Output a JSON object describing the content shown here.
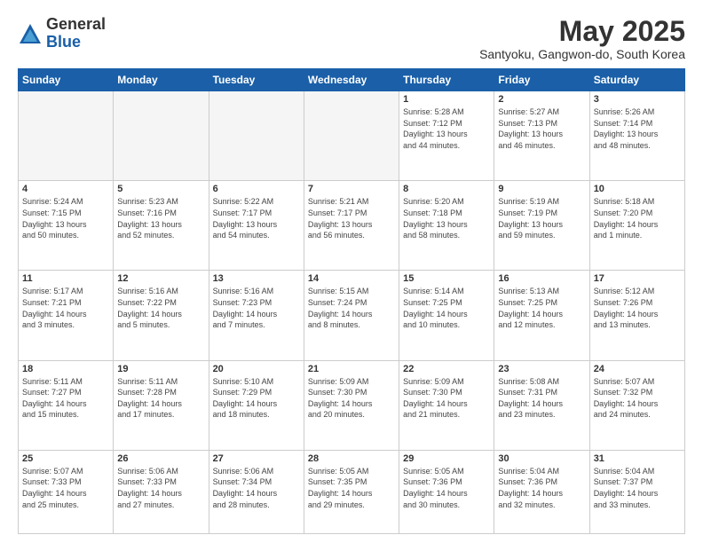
{
  "logo": {
    "general": "General",
    "blue": "Blue"
  },
  "title": "May 2025",
  "subtitle": "Santyoku, Gangwon-do, South Korea",
  "days_of_week": [
    "Sunday",
    "Monday",
    "Tuesday",
    "Wednesday",
    "Thursday",
    "Friday",
    "Saturday"
  ],
  "weeks": [
    [
      {
        "day": "",
        "info": ""
      },
      {
        "day": "",
        "info": ""
      },
      {
        "day": "",
        "info": ""
      },
      {
        "day": "",
        "info": ""
      },
      {
        "day": "1",
        "info": "Sunrise: 5:28 AM\nSunset: 7:12 PM\nDaylight: 13 hours\nand 44 minutes."
      },
      {
        "day": "2",
        "info": "Sunrise: 5:27 AM\nSunset: 7:13 PM\nDaylight: 13 hours\nand 46 minutes."
      },
      {
        "day": "3",
        "info": "Sunrise: 5:26 AM\nSunset: 7:14 PM\nDaylight: 13 hours\nand 48 minutes."
      }
    ],
    [
      {
        "day": "4",
        "info": "Sunrise: 5:24 AM\nSunset: 7:15 PM\nDaylight: 13 hours\nand 50 minutes."
      },
      {
        "day": "5",
        "info": "Sunrise: 5:23 AM\nSunset: 7:16 PM\nDaylight: 13 hours\nand 52 minutes."
      },
      {
        "day": "6",
        "info": "Sunrise: 5:22 AM\nSunset: 7:17 PM\nDaylight: 13 hours\nand 54 minutes."
      },
      {
        "day": "7",
        "info": "Sunrise: 5:21 AM\nSunset: 7:17 PM\nDaylight: 13 hours\nand 56 minutes."
      },
      {
        "day": "8",
        "info": "Sunrise: 5:20 AM\nSunset: 7:18 PM\nDaylight: 13 hours\nand 58 minutes."
      },
      {
        "day": "9",
        "info": "Sunrise: 5:19 AM\nSunset: 7:19 PM\nDaylight: 13 hours\nand 59 minutes."
      },
      {
        "day": "10",
        "info": "Sunrise: 5:18 AM\nSunset: 7:20 PM\nDaylight: 14 hours\nand 1 minute."
      }
    ],
    [
      {
        "day": "11",
        "info": "Sunrise: 5:17 AM\nSunset: 7:21 PM\nDaylight: 14 hours\nand 3 minutes."
      },
      {
        "day": "12",
        "info": "Sunrise: 5:16 AM\nSunset: 7:22 PM\nDaylight: 14 hours\nand 5 minutes."
      },
      {
        "day": "13",
        "info": "Sunrise: 5:16 AM\nSunset: 7:23 PM\nDaylight: 14 hours\nand 7 minutes."
      },
      {
        "day": "14",
        "info": "Sunrise: 5:15 AM\nSunset: 7:24 PM\nDaylight: 14 hours\nand 8 minutes."
      },
      {
        "day": "15",
        "info": "Sunrise: 5:14 AM\nSunset: 7:25 PM\nDaylight: 14 hours\nand 10 minutes."
      },
      {
        "day": "16",
        "info": "Sunrise: 5:13 AM\nSunset: 7:25 PM\nDaylight: 14 hours\nand 12 minutes."
      },
      {
        "day": "17",
        "info": "Sunrise: 5:12 AM\nSunset: 7:26 PM\nDaylight: 14 hours\nand 13 minutes."
      }
    ],
    [
      {
        "day": "18",
        "info": "Sunrise: 5:11 AM\nSunset: 7:27 PM\nDaylight: 14 hours\nand 15 minutes."
      },
      {
        "day": "19",
        "info": "Sunrise: 5:11 AM\nSunset: 7:28 PM\nDaylight: 14 hours\nand 17 minutes."
      },
      {
        "day": "20",
        "info": "Sunrise: 5:10 AM\nSunset: 7:29 PM\nDaylight: 14 hours\nand 18 minutes."
      },
      {
        "day": "21",
        "info": "Sunrise: 5:09 AM\nSunset: 7:30 PM\nDaylight: 14 hours\nand 20 minutes."
      },
      {
        "day": "22",
        "info": "Sunrise: 5:09 AM\nSunset: 7:30 PM\nDaylight: 14 hours\nand 21 minutes."
      },
      {
        "day": "23",
        "info": "Sunrise: 5:08 AM\nSunset: 7:31 PM\nDaylight: 14 hours\nand 23 minutes."
      },
      {
        "day": "24",
        "info": "Sunrise: 5:07 AM\nSunset: 7:32 PM\nDaylight: 14 hours\nand 24 minutes."
      }
    ],
    [
      {
        "day": "25",
        "info": "Sunrise: 5:07 AM\nSunset: 7:33 PM\nDaylight: 14 hours\nand 25 minutes."
      },
      {
        "day": "26",
        "info": "Sunrise: 5:06 AM\nSunset: 7:33 PM\nDaylight: 14 hours\nand 27 minutes."
      },
      {
        "day": "27",
        "info": "Sunrise: 5:06 AM\nSunset: 7:34 PM\nDaylight: 14 hours\nand 28 minutes."
      },
      {
        "day": "28",
        "info": "Sunrise: 5:05 AM\nSunset: 7:35 PM\nDaylight: 14 hours\nand 29 minutes."
      },
      {
        "day": "29",
        "info": "Sunrise: 5:05 AM\nSunset: 7:36 PM\nDaylight: 14 hours\nand 30 minutes."
      },
      {
        "day": "30",
        "info": "Sunrise: 5:04 AM\nSunset: 7:36 PM\nDaylight: 14 hours\nand 32 minutes."
      },
      {
        "day": "31",
        "info": "Sunrise: 5:04 AM\nSunset: 7:37 PM\nDaylight: 14 hours\nand 33 minutes."
      }
    ]
  ]
}
